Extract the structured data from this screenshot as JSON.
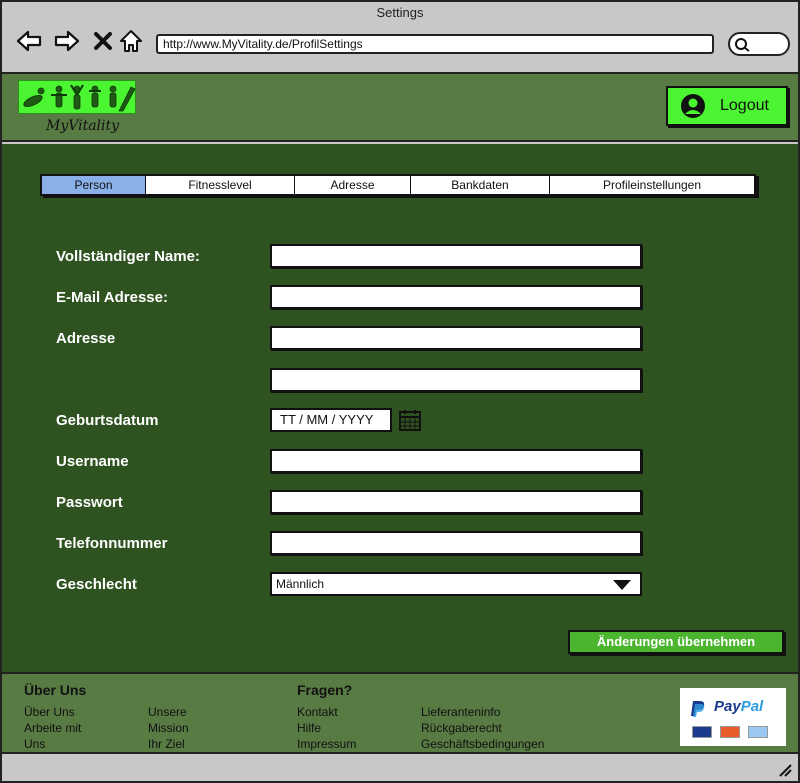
{
  "window": {
    "title": "Settings"
  },
  "browser": {
    "url": "http://www.MyVitality.de/ProfilSettings"
  },
  "header": {
    "logo_text": "MyVitality",
    "logout_label": "Logout"
  },
  "tabs": [
    {
      "label": "Person",
      "active": true
    },
    {
      "label": "Fitnesslevel",
      "active": false
    },
    {
      "label": "Adresse",
      "active": false
    },
    {
      "label": "Bankdaten",
      "active": false
    },
    {
      "label": "Profileinstellungen",
      "active": false
    }
  ],
  "form": {
    "name_label": "Vollständiger Name:",
    "email_label": "E-Mail Adresse:",
    "address_label": "Adresse",
    "birthdate_label": "Geburtsdatum",
    "birthdate_placeholder": "TT / MM / YYYY",
    "username_label": "Username",
    "password_label": "Passwort",
    "phone_label": "Telefonnummer",
    "gender_label": "Geschlecht",
    "gender_value": "Männlich",
    "apply_label": "Änderungen übernehmen"
  },
  "footer": {
    "about_heading": "Über Uns",
    "about_links": [
      "Über Uns",
      "Arbeite mit",
      "Uns"
    ],
    "mission_links": [
      "Unsere",
      "Mission",
      "Ihr Ziel"
    ],
    "questions_heading": "Fragen?",
    "question_links": [
      "Kontakt",
      "Hilfe",
      "Impressum"
    ],
    "info_links": [
      "Lieferanteninfo",
      "Rückgaberecht",
      "Geschäftsbedingungen"
    ],
    "paypal_label_1": "Pay",
    "paypal_label_2": "Pal"
  },
  "colors": {
    "header_bg": "#587a43",
    "main_bg": "#2f5320",
    "accent_green": "#4cf531",
    "active_tab": "#89b0e8"
  }
}
